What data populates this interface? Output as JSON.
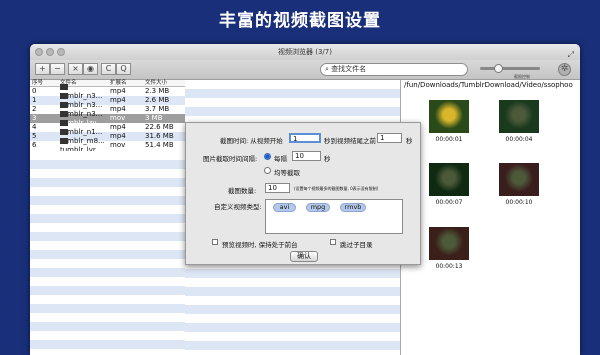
{
  "banner": {
    "text": "丰富的视频截图设置"
  },
  "window": {
    "title": "视频浏览器 (3/7)"
  },
  "toolbar": {
    "buttons": [
      {
        "icon": "add-icon",
        "glyph": "+"
      },
      {
        "icon": "remove-icon",
        "glyph": "−"
      },
      {
        "icon": "close-icon",
        "glyph": "×"
      },
      {
        "icon": "eye-icon",
        "glyph": "◉"
      },
      {
        "icon": "refresh-icon",
        "glyph": "C"
      },
      {
        "icon": "search-icon",
        "glyph": "Q"
      }
    ],
    "search_text": "查找文件名",
    "slider_label": "截图控制"
  },
  "filelist": {
    "headers": {
      "index": "序号",
      "name": "文件名",
      "ext": "扩展名",
      "size": "文件大小"
    },
    "rows": [
      {
        "index": "0",
        "name": "tumblr_n3...",
        "ext": "mp4",
        "size": "2.3 MB"
      },
      {
        "index": "1",
        "name": "tumblr_n3...",
        "ext": "mp4",
        "size": "2.6 MB"
      },
      {
        "index": "2",
        "name": "tumblr_n3...",
        "ext": "mp4",
        "size": "3.7 MB"
      },
      {
        "index": "3",
        "name": "tumblr_lzy...",
        "ext": "mov",
        "size": "3 MB"
      },
      {
        "index": "4",
        "name": "tumblr_n1...",
        "ext": "mp4",
        "size": "22.6 MB"
      },
      {
        "index": "5",
        "name": "tumblr_m8...",
        "ext": "mp4",
        "size": "31.6 MB"
      },
      {
        "index": "6",
        "name": "tumblr_lvr...",
        "ext": "mov",
        "size": "51.4 MB"
      }
    ],
    "selected_index": 3
  },
  "preview": {
    "path": "/fun/Downloads/TumblrDownload/Video/ssophoo",
    "frames": [
      {
        "time": "00:00:01",
        "color": "#2a4a1a"
      },
      {
        "time": "00:00:04",
        "color": "#1a3a1e"
      },
      {
        "time": "00:00:07",
        "color": "#0f2a10"
      },
      {
        "time": "00:00:10",
        "color": "#3a1e1e"
      },
      {
        "time": "00:00:13",
        "color": "#3a2018"
      }
    ]
  },
  "dialog": {
    "capture_time_label": "截图时间: 从视频开始",
    "start_value": "1",
    "before_end_label": "秒到视频结尾之前",
    "end_value": "1",
    "unit_sec": "秒",
    "interval_label": "图片截取时间间隔:",
    "every_label": "每隔",
    "every_value": "10",
    "every_unit": "秒",
    "even_label": "均等截取",
    "count_label": "截图数量:",
    "count_value": "10",
    "count_hint": "(设置每个视频最多的截图数量, 0表示没有限制)",
    "types_label": "自定义视频类型:",
    "types": [
      "avi",
      "mpg",
      "rmvb"
    ],
    "keep_front_label": "预览视频时, 保持处于前台",
    "skip_sub_label": "跳过子目录",
    "ok_label": "确认"
  }
}
